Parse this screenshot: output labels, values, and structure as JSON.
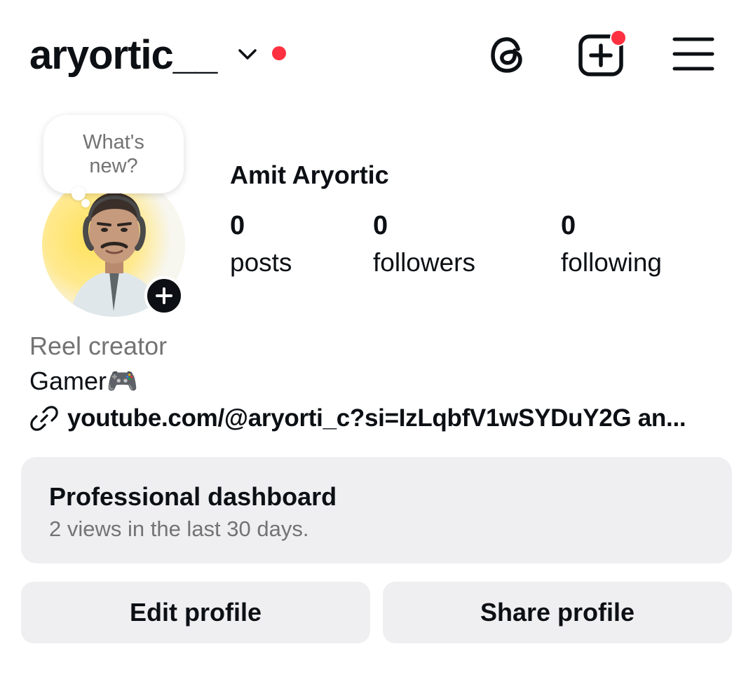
{
  "header": {
    "username": "aryortic__",
    "has_notification": true,
    "icons": [
      "chevron-down-icon",
      "threads-icon",
      "create-post-icon",
      "menu-icon"
    ],
    "accent_color": "#ff3040"
  },
  "note": {
    "text_line1": "What's",
    "text_line2": "new?"
  },
  "profile": {
    "full_name": "Amit Aryortic",
    "stats": [
      {
        "value": "0",
        "label": "posts"
      },
      {
        "value": "0",
        "label": "followers"
      },
      {
        "value": "0",
        "label": "following"
      }
    ],
    "category": "Reel creator",
    "bio": "Gamer🎮",
    "link": "youtube.com/@aryorti_c?si=IzLqbfV1wSYDuY2G an..."
  },
  "dashboard": {
    "title": "Professional dashboard",
    "subtitle": "2 views in the last 30 days."
  },
  "actions": {
    "edit_label": "Edit profile",
    "share_label": "Share profile"
  }
}
